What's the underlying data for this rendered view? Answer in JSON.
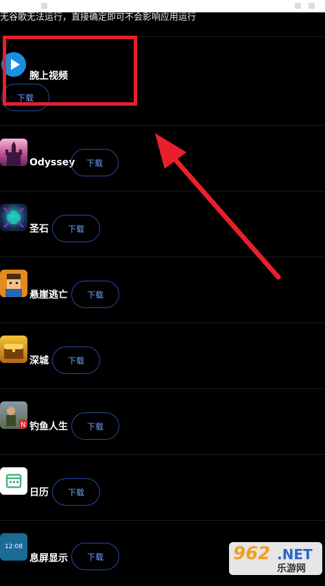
{
  "notice_text": "无谷歌无法运行，直接确定即可不会影响应用运行",
  "download_label": "下载",
  "apps": [
    {
      "name": "腕上视频",
      "icon": "play-circle-icon"
    },
    {
      "name": "Odyssey",
      "icon": "castle-icon"
    },
    {
      "name": "圣石",
      "icon": "monster-icon"
    },
    {
      "name": "悬崖逃亡",
      "icon": "character-icon"
    },
    {
      "name": "深城",
      "icon": "treasure-icon"
    },
    {
      "name": "钓鱼人生",
      "icon": "fisherman-icon"
    },
    {
      "name": "日历",
      "icon": "calendar-icon"
    },
    {
      "name": "息屏显示",
      "icon": "clock-screen-icon"
    }
  ],
  "calendar_icon_text": "12:08",
  "watermark": {
    "brand": "962",
    "suffix": ".NET",
    "sub": "乐游网"
  },
  "colors": {
    "background": "#000000",
    "accent": "#6aa0ff",
    "annotation": "#e8202c"
  }
}
